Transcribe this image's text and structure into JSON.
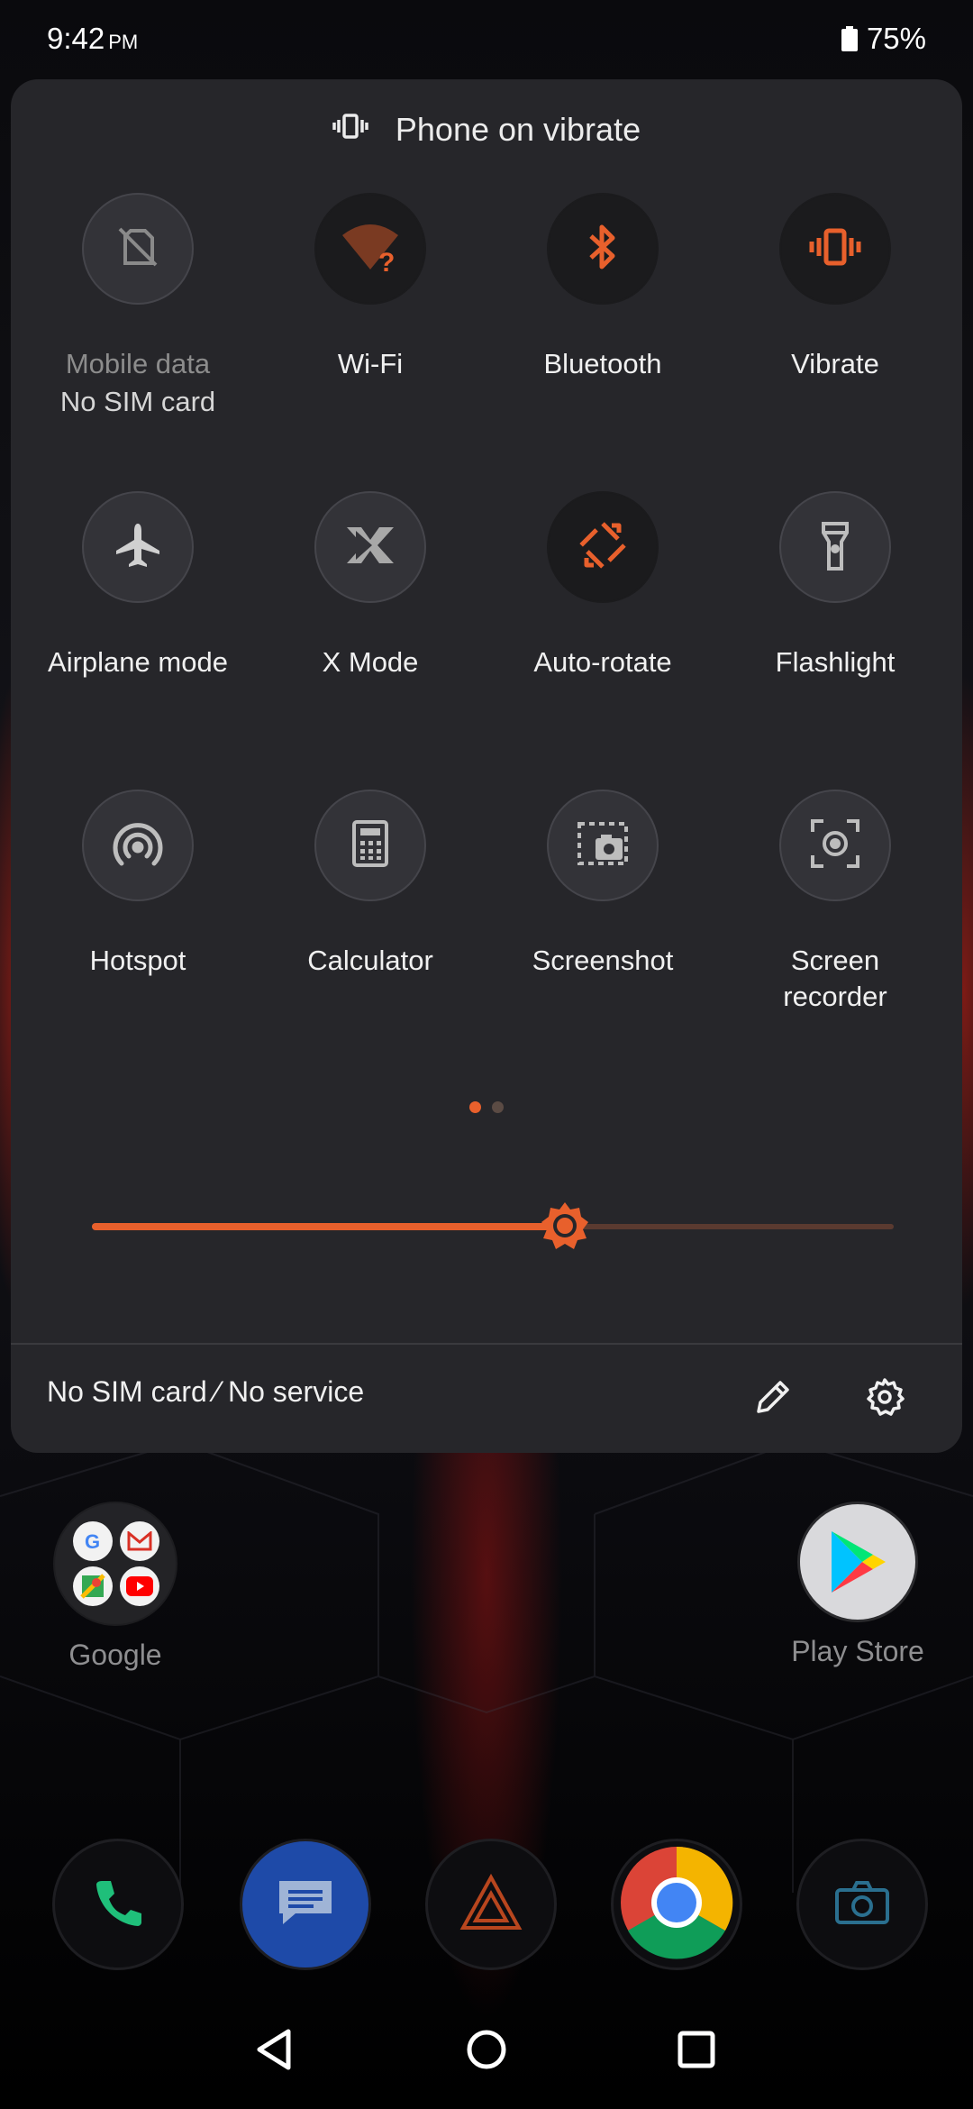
{
  "status_bar": {
    "time": "9:42",
    "ampm": "PM",
    "battery_percent": "75%"
  },
  "quick_settings": {
    "header_text": "Phone on vibrate",
    "tiles": [
      {
        "label": "Mobile data",
        "sublabel": "No SIM card",
        "icon": "no-sim-icon",
        "state": "unavailable"
      },
      {
        "label": "Wi-Fi",
        "icon": "wifi-question-icon",
        "state": "on"
      },
      {
        "label": "Bluetooth",
        "icon": "bluetooth-icon",
        "state": "on"
      },
      {
        "label": "Vibrate",
        "icon": "vibrate-icon",
        "state": "on"
      },
      {
        "label": "Airplane mode",
        "icon": "airplane-icon",
        "state": "off"
      },
      {
        "label": "X Mode",
        "icon": "x-mode-icon",
        "state": "off"
      },
      {
        "label": "Auto-rotate",
        "icon": "auto-rotate-icon",
        "state": "on"
      },
      {
        "label": "Flashlight",
        "icon": "flashlight-icon",
        "state": "off"
      },
      {
        "label": "Hotspot",
        "icon": "hotspot-icon",
        "state": "off"
      },
      {
        "label": "Calculator",
        "icon": "calculator-icon",
        "state": "off"
      },
      {
        "label": "Screenshot",
        "icon": "screenshot-icon",
        "state": "off"
      },
      {
        "label": "Screen recorder",
        "icon": "screen-recorder-icon",
        "state": "off"
      }
    ],
    "page_count": 2,
    "current_page": 1,
    "brightness_fraction": 0.59,
    "carrier_text": "No SIM card ⁄ No service",
    "footer_icons": [
      "edit-pencil-icon",
      "settings-gear-icon"
    ]
  },
  "home": {
    "folder": {
      "name": "Google",
      "apps": [
        "google-icon",
        "gmail-icon",
        "maps-icon",
        "youtube-icon"
      ]
    },
    "play_store": {
      "name": "Play Store"
    },
    "dock": [
      "phone-icon",
      "messages-icon",
      "armoury-icon",
      "chrome-icon",
      "camera-icon"
    ]
  },
  "nav_bar": {
    "buttons": [
      "back-icon",
      "home-icon",
      "recents-icon"
    ]
  },
  "colors": {
    "accent": "#e8602c",
    "panel": "#26262a",
    "tile_off": "#333338"
  }
}
